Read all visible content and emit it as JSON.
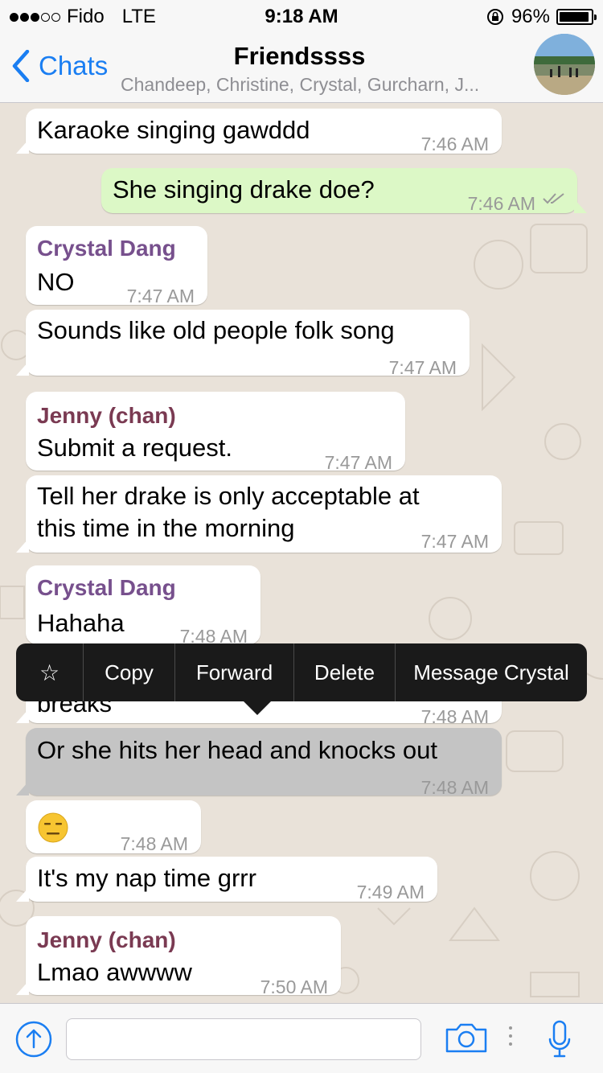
{
  "status": {
    "carrier": "Fido",
    "network": "LTE",
    "time": "9:18 AM",
    "battery": "96%",
    "battery_level": 0.96
  },
  "header": {
    "back_label": "Chats",
    "title": "Friendssss",
    "subtitle": "Chandeep, Christine, Crystal, Gurcharn, J..."
  },
  "messages": [
    {
      "text": "Karaoke singing gawddd",
      "time": "7:46 AM"
    },
    {
      "text": "She singing drake doe?",
      "time": "7:46 AM"
    },
    {
      "sender": "Crystal Dang",
      "text": "NO",
      "time": "7:47 AM"
    },
    {
      "text": "Sounds like old people folk song",
      "time": "7:47 AM"
    },
    {
      "sender": "Jenny (chan)",
      "text": "Submit a request.",
      "time": "7:47 AM"
    },
    {
      "text_line1": "Tell her drake is only acceptable at",
      "text_line2": "this time in the morning",
      "time": "7:47 AM"
    },
    {
      "sender": "Crystal Dang",
      "text": "Hahaha",
      "time": "7:48 AM"
    },
    {
      "text": "breaks",
      "time": "7:48 AM"
    },
    {
      "text": "Or she hits her head and knocks out",
      "time": "7:48 AM"
    },
    {
      "emoji": "😑",
      "time": "7:48 AM"
    },
    {
      "text": "It's my nap time grrr",
      "time": "7:49 AM"
    },
    {
      "sender": "Jenny (chan)",
      "text": "Lmao awwww",
      "time": "7:50 AM"
    }
  ],
  "context_menu": {
    "star": "☆",
    "copy": "Copy",
    "forward": "Forward",
    "delete": "Delete",
    "message": "Message Crystal"
  },
  "input": {
    "placeholder": ""
  },
  "colors": {
    "accent": "#1a7ef2",
    "outgoing_bubble": "#dcf8c6",
    "crystal_name": "#77508d",
    "jenny_name": "#7a3a52"
  }
}
